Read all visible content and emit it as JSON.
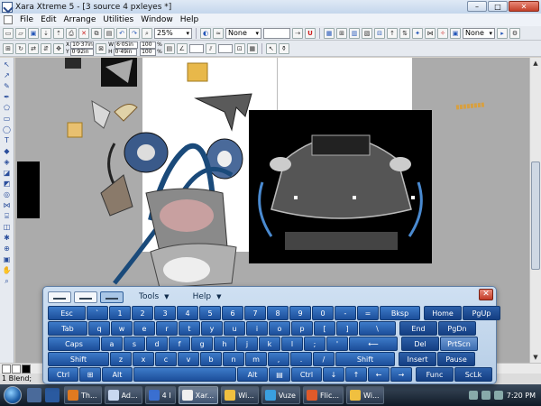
{
  "window": {
    "title": "Xara Xtreme 5 - [3 source 4 pxleyes *]",
    "buttons": [
      "–",
      "□",
      "✕"
    ]
  },
  "menubar": {
    "items": [
      "File",
      "Edit",
      "Arrange",
      "Utilities",
      "Window",
      "Help"
    ]
  },
  "toolbar1": {
    "zoom": "25%",
    "feather": "None",
    "flatness": "None",
    "icons": [
      "new-icon",
      "open-icon",
      "save-icon",
      "import-icon",
      "export-icon",
      "print-icon",
      "delete-icon",
      "copy-icon",
      "paste-icon",
      "undo-icon",
      "redo-icon",
      "zoom-icon"
    ]
  },
  "toolbar2": {
    "x": "10·37in",
    "y": "0·92in",
    "w": "6·05in",
    "h": "0·49in",
    "scale_w": "100",
    "scale_h": "100",
    "pct": "%"
  },
  "osk": {
    "menus": [
      "Tools",
      "Help"
    ],
    "close": "✕",
    "rows": [
      [
        "Esc",
        "`",
        "1",
        "2",
        "3",
        "4",
        "5",
        "6",
        "7",
        "8",
        "9",
        "0",
        "-",
        "=",
        "Bksp",
        "Home",
        "PgUp"
      ],
      [
        "Tab",
        "q",
        "w",
        "e",
        "r",
        "t",
        "y",
        "u",
        "i",
        "o",
        "p",
        "[",
        "]",
        "\\",
        "End",
        "PgDn"
      ],
      [
        "Caps",
        "a",
        "s",
        "d",
        "f",
        "g",
        "h",
        "j",
        "k",
        "l",
        ";",
        "'",
        "⟵",
        "Del",
        "PrtScn"
      ],
      [
        "Shift",
        "z",
        "x",
        "c",
        "v",
        "b",
        "n",
        "m",
        ",",
        ".",
        "/",
        "Shift",
        "Insert",
        "Pause"
      ],
      [
        "Ctrl",
        "⊞",
        "Alt",
        "",
        "Alt",
        "▤",
        "Ctrl",
        "↓",
        "↑",
        "←",
        "→",
        "Func",
        "ScLk"
      ]
    ]
  },
  "status": {
    "text": "1 Blend;"
  },
  "taskbar": {
    "tasks": [
      {
        "label": "Th...",
        "color": "#e07a20"
      },
      {
        "label": "Ad...",
        "color": "#c8d8f0"
      },
      {
        "label": "4 I",
        "color": "#3a6fd0"
      },
      {
        "label": "Xar...",
        "color": "#f0f0f0"
      },
      {
        "label": "Wi...",
        "color": "#f0c040"
      },
      {
        "label": "Vuze",
        "color": "#3aa0e0"
      },
      {
        "label": "Flic...",
        "color": "#e05a2a"
      },
      {
        "label": "Wi...",
        "color": "#f0c040"
      }
    ],
    "clock": "7:20 PM"
  },
  "colors": {
    "accent": "#1c4e9a",
    "canvas": "#ababab"
  }
}
